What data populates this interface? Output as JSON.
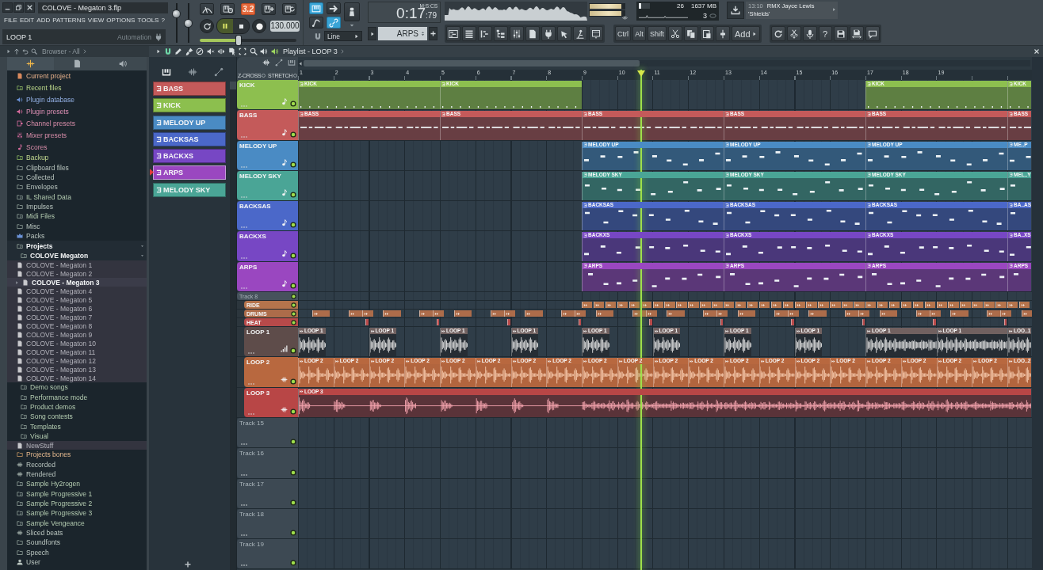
{
  "window": {
    "title": "COLOVE - Megaton 3.flp"
  },
  "menu": [
    "FILE",
    "EDIT",
    "ADD",
    "PATTERNS",
    "VIEW",
    "OPTIONS",
    "TOOLS",
    "?"
  ],
  "hint_bar": {
    "text": "LOOP 1",
    "mode": "Automation"
  },
  "master": {
    "volume": {
      "level": 0.78
    },
    "pitch": {
      "level": 0.5
    }
  },
  "transport": {
    "record_options": [
      {
        "kind": "metronome",
        "on": false
      },
      {
        "kind": "wait",
        "on": false
      },
      {
        "kind": "countdown",
        "label": "3.2",
        "on": true
      },
      {
        "kind": "step",
        "on": false
      },
      {
        "kind": "overdub",
        "on": false
      }
    ],
    "playing": true,
    "recording": false,
    "tempo": "130.000",
    "position": {
      "level": 0.4
    }
  },
  "modes": [
    {
      "kind": "keyboard",
      "on": true
    },
    {
      "kind": "arrow",
      "on": false
    },
    {
      "kind": "knob",
      "on": false
    },
    {
      "kind": "curve",
      "on": false
    },
    {
      "kind": "link",
      "on": true
    }
  ],
  "snap": {
    "value": "Line"
  },
  "time": {
    "main": "0:17",
    "fraction": ":79",
    "unit": "M:S:CS"
  },
  "pattern_selector": {
    "value": "ARPS"
  },
  "peak_meter": [
    {
      "level": 0.9
    },
    {
      "level": 0.9
    }
  ],
  "cpu_panel": {
    "level": 0.22,
    "cpu": "26",
    "memory": "1637 MB",
    "polyphony": "3"
  },
  "news": {
    "time": "13:10",
    "headline": "RMX Jayce Lewis",
    "subtitle": "'Shields'"
  },
  "shortcuts": {
    "modifiers": [
      "Ctrl",
      "Alt",
      "Shift"
    ],
    "add": "Add",
    "help": "?"
  },
  "browser": {
    "title": "Browser - All",
    "tabs": [
      {
        "kind": "all",
        "selected": true
      },
      {
        "kind": "files",
        "selected": false
      },
      {
        "kind": "plugins",
        "selected": false
      }
    ],
    "items": [
      {
        "label": "Current project",
        "kind": "project",
        "selected": false
      },
      {
        "label": "Recent files",
        "kind": "recent",
        "selected": false
      },
      {
        "label": "Plugin database",
        "kind": "database",
        "selected": false
      },
      {
        "label": "Plugin presets",
        "kind": "plugin",
        "selected": false
      },
      {
        "label": "Channel presets",
        "kind": "channel",
        "selected": false
      },
      {
        "label": "Mixer presets",
        "kind": "mixer",
        "selected": false
      },
      {
        "label": "Scores",
        "kind": "scores",
        "selected": false
      },
      {
        "label": "Backup",
        "kind": "backup",
        "selected": false
      },
      {
        "label": "Clipboard files",
        "kind": "folder",
        "selected": false
      },
      {
        "label": "Collected",
        "kind": "folder",
        "selected": false
      },
      {
        "label": "Envelopes",
        "kind": "folder",
        "selected": false
      },
      {
        "label": "IL Shared Data",
        "kind": "linked",
        "selected": false
      },
      {
        "label": "Impulses",
        "kind": "folder",
        "selected": false
      },
      {
        "label": "Midi Files",
        "kind": "linked",
        "selected": false
      },
      {
        "label": "Misc",
        "kind": "folder",
        "selected": false
      },
      {
        "label": "Packs",
        "kind": "packs",
        "selected": false
      },
      {
        "label": "Projects",
        "kind": "linked",
        "selected": false,
        "children": [
          {
            "label": "COLOVE Megaton",
            "kind": "linked",
            "selected": false,
            "children": [
              {
                "label": "COLOVE - Megaton 1",
                "kind": "file",
                "selected": false
              },
              {
                "label": "COLOVE - Megaton 2",
                "kind": "file",
                "selected": false
              },
              {
                "label": "COLOVE - Megaton 3",
                "kind": "file",
                "selected": true
              },
              {
                "label": "COLOVE - Megaton 4",
                "kind": "file",
                "selected": false
              },
              {
                "label": "COLOVE - Megaton 5",
                "kind": "file",
                "selected": false
              },
              {
                "label": "COLOVE - Megaton 6",
                "kind": "file",
                "selected": false
              },
              {
                "label": "COLOVE - Megaton 7",
                "kind": "file",
                "selected": false
              },
              {
                "label": "COLOVE - Megaton 8",
                "kind": "file",
                "selected": false
              },
              {
                "label": "COLOVE - Megaton 9",
                "kind": "file",
                "selected": false
              },
              {
                "label": "COLOVE - Megaton 10",
                "kind": "file",
                "selected": false
              },
              {
                "label": "COLOVE - Megaton 11",
                "kind": "file",
                "selected": false
              },
              {
                "label": "COLOVE - Megaton 12",
                "kind": "file",
                "selected": false
              },
              {
                "label": "COLOVE - Megaton 13",
                "kind": "file",
                "selected": false
              },
              {
                "label": "COLOVE - Megaton 14",
                "kind": "file",
                "selected": false
              }
            ]
          },
          {
            "label": "Demo songs",
            "kind": "linked",
            "selected": false
          },
          {
            "label": "Performance mode",
            "kind": "linked",
            "selected": false
          },
          {
            "label": "Product demos",
            "kind": "linked",
            "selected": false
          },
          {
            "label": "Song contests",
            "kind": "linked",
            "selected": false
          },
          {
            "label": "Templates",
            "kind": "linked",
            "selected": false
          },
          {
            "label": "Visual",
            "kind": "linked",
            "selected": false
          },
          {
            "label": "NewStuff",
            "kind": "file",
            "selected": false
          }
        ]
      },
      {
        "label": "Projects bones",
        "kind": "favorite",
        "selected": false
      },
      {
        "label": "Recorded",
        "kind": "waveform",
        "selected": false
      },
      {
        "label": "Rendered",
        "kind": "waveform",
        "selected": false
      },
      {
        "label": "Sample Hy2rogen",
        "kind": "linked",
        "selected": false
      },
      {
        "label": "Sample Progressive 1",
        "kind": "linked",
        "selected": false
      },
      {
        "label": "Sample Progressive 2",
        "kind": "linked",
        "selected": false
      },
      {
        "label": "Sample Progressive 3",
        "kind": "linked",
        "selected": false
      },
      {
        "label": "Sample Vengeance",
        "kind": "linked",
        "selected": false
      },
      {
        "label": "Sliced beats",
        "kind": "waveform",
        "selected": false
      },
      {
        "label": "Soundfonts",
        "kind": "folder",
        "selected": false
      },
      {
        "label": "Speech",
        "kind": "folder",
        "selected": false
      },
      {
        "label": "User",
        "kind": "user",
        "selected": false
      }
    ]
  },
  "playlist": {
    "title": "Playlist - LOOP 3",
    "picker_tabs": [
      {
        "kind": "patterns",
        "selected": true
      },
      {
        "kind": "audio",
        "selected": false
      },
      {
        "kind": "automation",
        "selected": false
      }
    ],
    "patterns": [
      {
        "name": "BASS",
        "color": "#c45a5a",
        "selected": false
      },
      {
        "name": "KICK",
        "color": "#8cbf4e",
        "selected": false
      },
      {
        "name": "MELODY UP",
        "color": "#4a8bc4",
        "selected": false
      },
      {
        "name": "BACKSAS",
        "color": "#4b68c9",
        "selected": false
      },
      {
        "name": "BACKXS",
        "color": "#7747c4",
        "selected": false
      },
      {
        "name": "ARPS",
        "color": "#9a47c0",
        "selected": true
      },
      {
        "name": "MELODY SKY",
        "color": "#4aa596",
        "selected": false
      }
    ],
    "options": [
      {
        "label": "Z-CROSS",
        "on": false
      },
      {
        "label": "STRETCH",
        "on": false
      }
    ],
    "ruler": [
      "1",
      "2",
      "3",
      "4",
      "5",
      "6",
      "7",
      "8",
      "9",
      "10",
      "11",
      "12",
      "13",
      "14",
      "15",
      "16",
      "17",
      "18",
      "19"
    ],
    "tracks": [
      {
        "name": "KICK",
        "color": "#8dbf4f",
        "kind": "pattern",
        "collapsed": false,
        "clips": [
          "KICK",
          "KICK",
          "KICK",
          "KICK"
        ]
      },
      {
        "name": "BASS",
        "color": "#c45a5a",
        "kind": "pattern",
        "collapsed": false,
        "clips": [
          "BASS",
          "BASS",
          "BASS",
          "BASS",
          "BASS",
          "BASS"
        ]
      },
      {
        "name": "MELODY UP",
        "color": "#4a8bc4",
        "kind": "pattern",
        "collapsed": false,
        "clips": [
          "MELODY UP",
          "MELODY UP",
          "MELODY UP",
          "ME..P"
        ]
      },
      {
        "name": "MELODY SKY",
        "color": "#4aa596",
        "kind": "pattern",
        "collapsed": false,
        "clips": [
          "MELODY SKY",
          "MELODY SKY",
          "MELODY SKY",
          "MEL..Y"
        ]
      },
      {
        "name": "BACKSAS",
        "color": "#4b68c9",
        "kind": "pattern",
        "collapsed": false,
        "clips": [
          "BACKSAS",
          "BACKSAS",
          "BACKSAS",
          "BA..AS"
        ]
      },
      {
        "name": "BACKXS",
        "color": "#7747c4",
        "kind": "pattern",
        "collapsed": false,
        "clips": [
          "BACKXS",
          "BACKXS",
          "BACKXS",
          "BA..XS"
        ]
      },
      {
        "name": "ARPS",
        "color": "#9a47c0",
        "kind": "pattern",
        "collapsed": false,
        "clips": [
          "ARPS",
          "ARPS",
          "ARPS",
          "ARPS"
        ]
      },
      {
        "name": "Track 8",
        "color": "#46525c",
        "kind": "empty",
        "collapsed": true,
        "children": [
          {
            "name": "RIDE",
            "color": "#b5744c",
            "kind": "drum",
            "collapsed": true
          },
          {
            "name": "DRUMS",
            "color": "#ad6c4a",
            "kind": "drum",
            "collapsed": true
          },
          {
            "name": "HEAT",
            "color": "#b84a4a",
            "kind": "drum",
            "collapsed": true
          },
          {
            "name": "LOOP 1",
            "color": "#5e4c4a",
            "kind": "sliced",
            "collapsed": false,
            "clips": [
              "LOOP 1",
              "LOOP 1",
              "LOOP 1",
              "LOOP 1",
              "LOOP 1",
              "LOOP 1",
              "LOOP 1",
              "LOOP 1",
              "LOOP 1",
              "LOOP 1",
              "LOO..1"
            ]
          },
          {
            "name": "LOOP 2",
            "color": "#b8683f",
            "kind": "audio",
            "collapsed": false,
            "clips": [
              "LOOP 2",
              "LOOP 2",
              "LOOP 2",
              "LOOP 2",
              "LOOP 2",
              "LOOP 2",
              "LOOP 2",
              "LOOP 2",
              "LOOP 2",
              "LOOP 2",
              "LOOP 2",
              "LOOP 2",
              "LOOP 2",
              "LOOP 2",
              "LOOP 2",
              "LOOP 2",
              "LOOP 2",
              "LOOP 2",
              "LOOP 2",
              "LOOP 2",
              "LOO..2"
            ]
          },
          {
            "name": "LOOP 3",
            "color": "#b84646",
            "kind": "audio",
            "collapsed": false,
            "clips": [
              "LOOP 3"
            ]
          }
        ]
      },
      {
        "name": "Track 15",
        "color": "#3d4953",
        "kind": "empty",
        "collapsed": false
      },
      {
        "name": "Track 16",
        "color": "#3d4953",
        "kind": "empty",
        "collapsed": false
      },
      {
        "name": "Track 17",
        "color": "#3d4953",
        "kind": "empty",
        "collapsed": false
      },
      {
        "name": "Track 18",
        "color": "#3d4953",
        "kind": "empty",
        "collapsed": false
      },
      {
        "name": "Track 19",
        "color": "#3d4953",
        "kind": "empty",
        "collapsed": false
      }
    ]
  }
}
